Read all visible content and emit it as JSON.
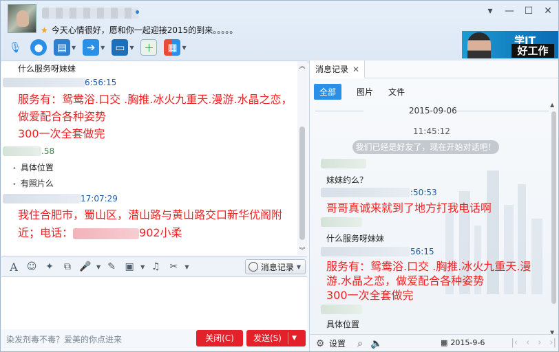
{
  "header": {
    "mood": "今天心情很好，愿和你一起迎接2015的到来。。。。。",
    "ad_line1": "学IT",
    "ad_line2": "好工作"
  },
  "window_buttons": [
    "▾",
    "—",
    "☐",
    "✕"
  ],
  "chat": {
    "line_service": "什么服务呀妹妹",
    "time1": "6:56:15",
    "msg1_line1": "服务有：鸳鸯浴.口交 .胸推.冰火九重天.漫游.水晶之恋，",
    "msg1_line2": "做爱配合各种姿势",
    "msg1_line3": "300一次全套做完",
    "time2": ".58",
    "item1": "具体位置",
    "item2": "有照片么",
    "time3": "17:07:29",
    "msg2_line1": "我住合肥市，蜀山区，潜山路与黄山路交口新华优阁附",
    "msg2_line2a": "近；电话：",
    "msg2_line2b": "902小柔"
  },
  "input_toolbar": {
    "history_button": "消息记录"
  },
  "footer": {
    "placeholder_ad": "染发剂毒不毒？爱美的你点进来",
    "close_button": "关闭(C)",
    "send_button": "发送(S)"
  },
  "history": {
    "tab_label": "消息记录",
    "filters": [
      "全部",
      "图片",
      "文件"
    ],
    "date": "2015-09-06",
    "time": "11:45:12",
    "notice": "我们已经是好友了，现在开始对话吧！",
    "msg_a": "妹妹约么？",
    "time_a": ":50:53",
    "msg_b": "哥哥真诚来就到了地方打我电话啊",
    "msg_c": "什么服务呀妹妹",
    "time_c": "56:15",
    "msg_d1": "服务有：鸳鸯浴.口交 .胸推.冰火九重天.漫",
    "msg_d2": "游.水晶之恋，做爱配合各种姿势",
    "msg_d3": "300一次全套做完",
    "msg_e": "具体位置",
    "settings_label": "设置",
    "footer_date": "2015-9-6"
  },
  "colors": {
    "accent_blue": "#2a8fe6",
    "message_red": "#e22222",
    "button_red": "#e4202b"
  }
}
